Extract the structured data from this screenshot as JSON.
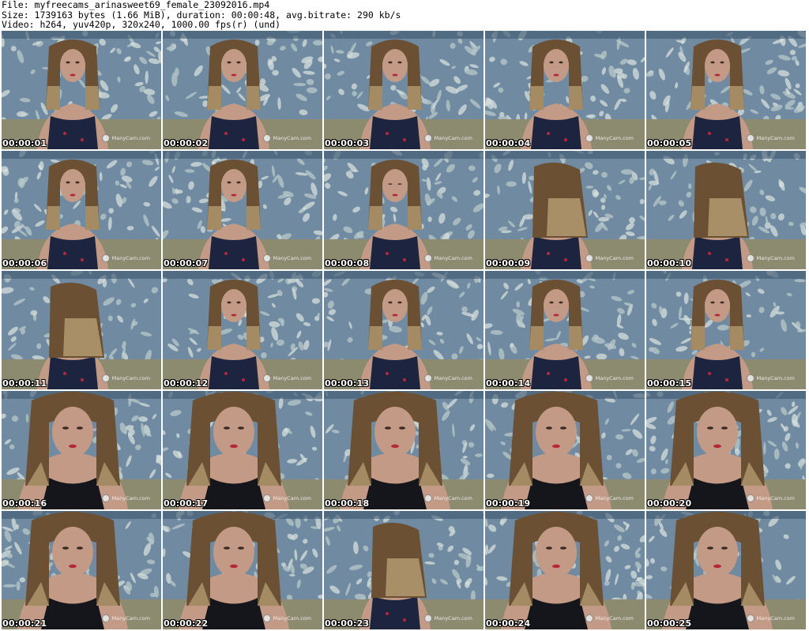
{
  "header": {
    "line1": "File: myfreecams_arinasweet69_female_23092016.mp4",
    "line2": "Size: 1739163 bytes (1.66 MiB), duration: 00:00:48, avg.bitrate: 290 kb/s",
    "line3": "Video: h264, yuv420p, 320x240, 1000.00 fps(r) (und)"
  },
  "watermark": "ManyCam.com",
  "thumbnails": [
    {
      "time": "00:00:01",
      "pose": "front"
    },
    {
      "time": "00:00:02",
      "pose": "front"
    },
    {
      "time": "00:00:03",
      "pose": "front"
    },
    {
      "time": "00:00:04",
      "pose": "front"
    },
    {
      "time": "00:00:05",
      "pose": "front"
    },
    {
      "time": "00:00:06",
      "pose": "front"
    },
    {
      "time": "00:00:07",
      "pose": "front"
    },
    {
      "time": "00:00:08",
      "pose": "down"
    },
    {
      "time": "00:00:09",
      "pose": "hair"
    },
    {
      "time": "00:00:10",
      "pose": "hair"
    },
    {
      "time": "00:00:11",
      "pose": "hair"
    },
    {
      "time": "00:00:12",
      "pose": "front"
    },
    {
      "time": "00:00:13",
      "pose": "front"
    },
    {
      "time": "00:00:14",
      "pose": "front"
    },
    {
      "time": "00:00:15",
      "pose": "front"
    },
    {
      "time": "00:00:16",
      "pose": "close"
    },
    {
      "time": "00:00:17",
      "pose": "close"
    },
    {
      "time": "00:00:18",
      "pose": "close"
    },
    {
      "time": "00:00:19",
      "pose": "close"
    },
    {
      "time": "00:00:20",
      "pose": "close"
    },
    {
      "time": "00:00:21",
      "pose": "close"
    },
    {
      "time": "00:00:22",
      "pose": "close"
    },
    {
      "time": "00:00:23",
      "pose": "hair"
    },
    {
      "time": "00:00:24",
      "pose": "close"
    },
    {
      "time": "00:00:25",
      "pose": "close"
    }
  ],
  "colors": {
    "wallpaper": "#6f8aa1",
    "wallpaper_light": "#b7c8c9",
    "hair": "#6b5033",
    "hair_light": "#b39a71",
    "skin": "#c39a86",
    "top": "#1c2440",
    "couch": "#8d8b6f"
  }
}
